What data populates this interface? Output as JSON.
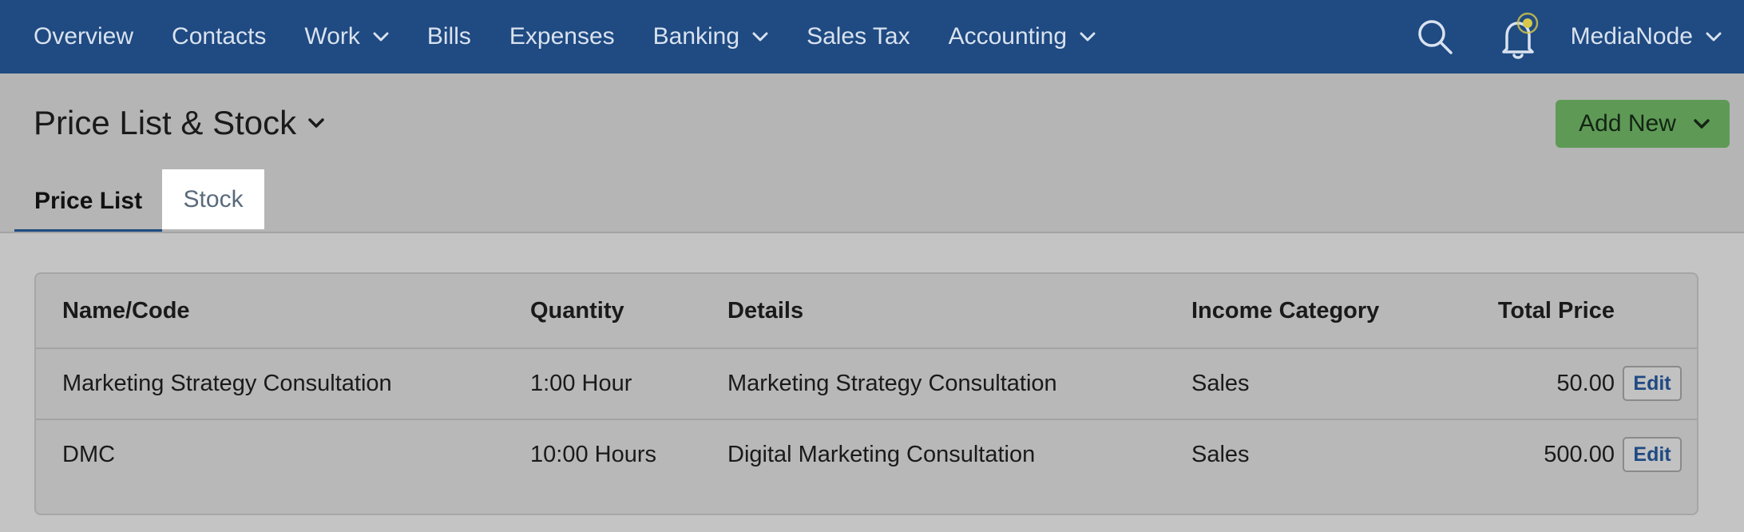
{
  "nav": {
    "items": [
      {
        "label": "Overview",
        "has_dropdown": false
      },
      {
        "label": "Contacts",
        "has_dropdown": false
      },
      {
        "label": "Work",
        "has_dropdown": true
      },
      {
        "label": "Bills",
        "has_dropdown": false
      },
      {
        "label": "Expenses",
        "has_dropdown": false
      },
      {
        "label": "Banking",
        "has_dropdown": true
      },
      {
        "label": "Sales Tax",
        "has_dropdown": false
      },
      {
        "label": "Accounting",
        "has_dropdown": true
      }
    ],
    "search_icon": "search-icon",
    "notification_icon": "bell-icon",
    "account_label": "MediaNode"
  },
  "header": {
    "title": "Price List & Stock",
    "add_new_label": "Add New",
    "tabs": [
      {
        "label": "Price List",
        "active": true
      },
      {
        "label": "Stock",
        "active": false
      }
    ]
  },
  "table": {
    "columns": {
      "name": "Name/Code",
      "quantity": "Quantity",
      "details": "Details",
      "category": "Income Category",
      "total": "Total Price"
    },
    "rows": [
      {
        "name": "Marketing Strategy Consultation",
        "quantity": "1:00 Hour",
        "details": "Marketing Strategy Consultation",
        "category": "Sales",
        "total": "50.00",
        "action": "Edit"
      },
      {
        "name": "DMC",
        "quantity": "10:00 Hours",
        "details": "Digital Marketing Consultation",
        "category": "Sales",
        "total": "500.00",
        "action": "Edit"
      }
    ]
  },
  "colors": {
    "nav_bg": "#1f4a82",
    "accent_green": "#5e9a56",
    "notification_dot": "#d6c84a"
  }
}
